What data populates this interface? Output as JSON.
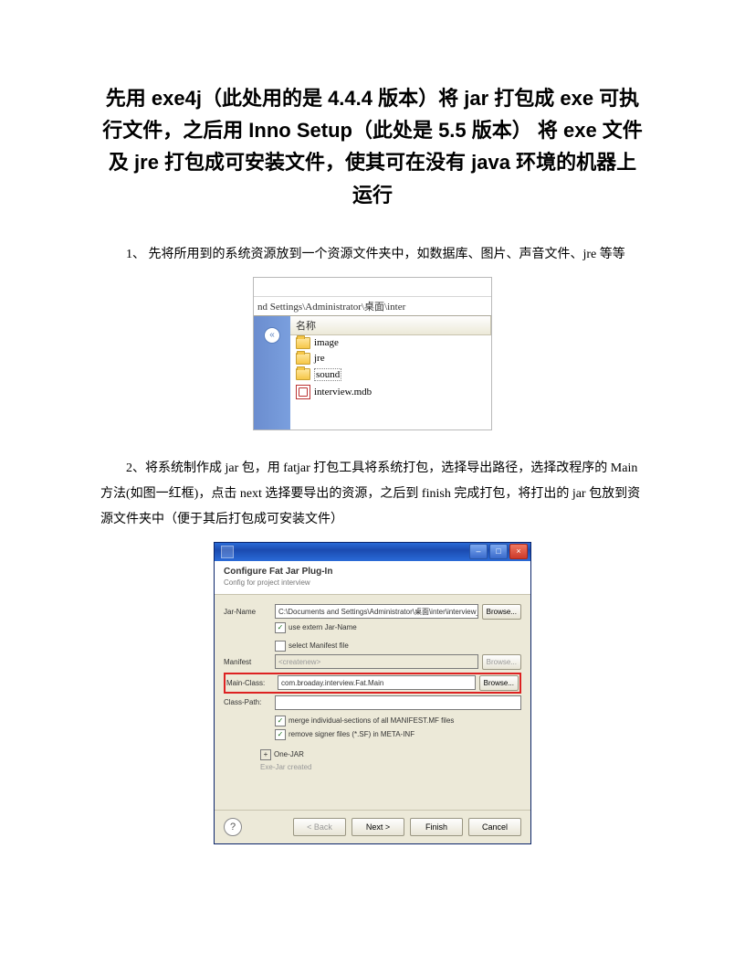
{
  "title": "先用 exe4j（此处用的是 4.4.4 版本）将 jar 打包成 exe 可执行文件，之后用 Inno Setup（此处是 5.5 版本） 将 exe 文件及 jre 打包成可安装文件，使其可在没有 java 环境的机器上运行",
  "para1": "1、 先将所用到的系统资源放到一个资源文件夹中，如数据库、图片、声音文件、jre 等等",
  "para2": "2、将系统制作成 jar 包，用 fatjar 打包工具将系统打包，选择导出路径，选择改程序的 Main 方法(如图一红框)，点击 next 选择要导出的资源，之后到 finish 完成打包，将打出的 jar 包放到资源文件夹中（便于其后打包成可安装文件）",
  "explorer": {
    "address": "nd Settings\\Administrator\\桌面\\inter",
    "column": "名称",
    "items": [
      {
        "name": "image",
        "type": "folder"
      },
      {
        "name": "jre",
        "type": "folder"
      },
      {
        "name": "sound",
        "type": "folder",
        "selected": true
      },
      {
        "name": "interview.mdb",
        "type": "mdb"
      }
    ],
    "collapse": "«"
  },
  "dialog": {
    "head_title": "Configure Fat Jar Plug-In",
    "head_sub": "Config for project interview",
    "labels": {
      "jar_name": "Jar-Name",
      "manifest": "Manifest",
      "main_class": "Main-Class:",
      "class_path": "Class-Path:"
    },
    "jar_name_value": "C:\\Documents and Settings\\Administrator\\桌面\\inter\\interview_mdb.jar",
    "use_extern": "use extern Jar-Name",
    "select_manifest": "select Manifest file",
    "manifest_value": "<createnew>",
    "main_class_value": "com.broaday.interview.Fat.Main",
    "merge": "merge individual-sections of all MANIFEST.MF files",
    "remove": "remove signer files (*.SF) in META-INF",
    "one_jar": "One-JAR",
    "finish": "Exe-Jar created",
    "browse": "Browse...",
    "buttons": {
      "back": "< Back",
      "next": "Next >",
      "finish": "Finish",
      "cancel": "Cancel"
    },
    "win_btns": {
      "min": "–",
      "max": "□",
      "close": "×"
    }
  }
}
